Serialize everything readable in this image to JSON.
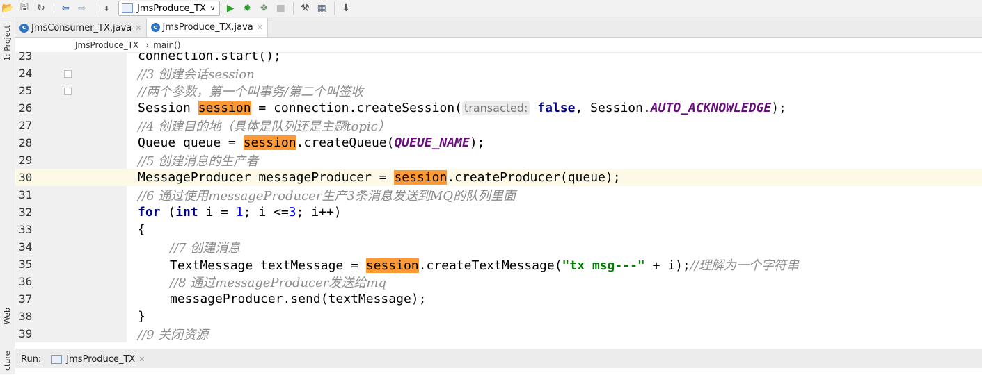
{
  "toolbar": {
    "run_config": "JmsProduce_TX"
  },
  "side_tabs": {
    "project": "1: Project",
    "web": "Web",
    "structure": "cture"
  },
  "tabs": [
    {
      "label": "JmsConsumer_TX.java"
    },
    {
      "label": "JmsProduce_TX.java"
    }
  ],
  "breadcrumb": {
    "class_name": "JmsProduce_TX",
    "separator": "›",
    "method": "main()"
  },
  "run": {
    "label": "Run:",
    "tab": "JmsProduce_TX"
  },
  "code_lines": [
    {
      "n": "23",
      "segments": [
        [
          "p",
          "connection.start();"
        ]
      ]
    },
    {
      "n": "24",
      "segments": [
        [
          "cm",
          "//3 创建会话session"
        ]
      ]
    },
    {
      "n": "25",
      "segments": [
        [
          "cm",
          "//两个参数，第一个叫事务/第二个叫签收"
        ]
      ]
    },
    {
      "n": "26",
      "segments": [
        [
          "p",
          "Session "
        ],
        [
          "hl",
          "session"
        ],
        [
          "p",
          " = connection.createSession("
        ],
        [
          "hint",
          "transacted:"
        ],
        [
          "p",
          " "
        ],
        [
          "kw",
          "false"
        ],
        [
          "p",
          ", Session."
        ],
        [
          "const",
          "AUTO_ACKNOWLEDGE"
        ],
        [
          "p",
          ");"
        ]
      ]
    },
    {
      "n": "27",
      "segments": [
        [
          "cm",
          "//4 创建目的地（具体是队列还是主题topic）"
        ]
      ]
    },
    {
      "n": "28",
      "segments": [
        [
          "p",
          "Queue queue = "
        ],
        [
          "hl",
          "session"
        ],
        [
          "p",
          ".createQueue("
        ],
        [
          "const",
          "QUEUE_NAME"
        ],
        [
          "p",
          ");"
        ]
      ]
    },
    {
      "n": "29",
      "segments": [
        [
          "cm",
          "//5 创建消息的生产者"
        ]
      ]
    },
    {
      "n": "30",
      "segments": [
        [
          "p",
          "MessageProducer messageProducer = "
        ],
        [
          "hl",
          "session"
        ],
        [
          "p",
          ".createProducer(queue);"
        ]
      ]
    },
    {
      "n": "31",
      "segments": [
        [
          "cm",
          "//6 通过使用messageProducer生产3条消息发送到MQ的队列里面"
        ]
      ]
    },
    {
      "n": "32",
      "segments": [
        [
          "kw",
          "for"
        ],
        [
          "p",
          " ("
        ],
        [
          "kw",
          "int"
        ],
        [
          "p",
          " i = "
        ],
        [
          "num",
          "1"
        ],
        [
          "p",
          "; i <="
        ],
        [
          "num",
          "3"
        ],
        [
          "p",
          "; i++)"
        ]
      ]
    },
    {
      "n": "33",
      "segments": [
        [
          "p",
          "{"
        ]
      ]
    },
    {
      "n": "34",
      "segments": [
        [
          "cm",
          "//7 创建消息"
        ]
      ]
    },
    {
      "n": "35",
      "segments": [
        [
          "p",
          "TextMessage textMessage = "
        ],
        [
          "hl",
          "session"
        ],
        [
          "p",
          ".createTextMessage("
        ],
        [
          "str",
          "\"tx msg---\""
        ],
        [
          "p",
          " + i);"
        ],
        [
          "cm",
          "//理解为一个字符串"
        ]
      ]
    },
    {
      "n": "36",
      "segments": [
        [
          "cm",
          "//8 通过messageProducer发送给mq"
        ]
      ]
    },
    {
      "n": "37",
      "segments": [
        [
          "p",
          "messageProducer.send(textMessage);"
        ]
      ]
    },
    {
      "n": "38",
      "segments": [
        [
          "p",
          "}"
        ]
      ]
    },
    {
      "n": "39",
      "segments": [
        [
          "cm",
          "//9 关闭资源"
        ]
      ]
    }
  ]
}
